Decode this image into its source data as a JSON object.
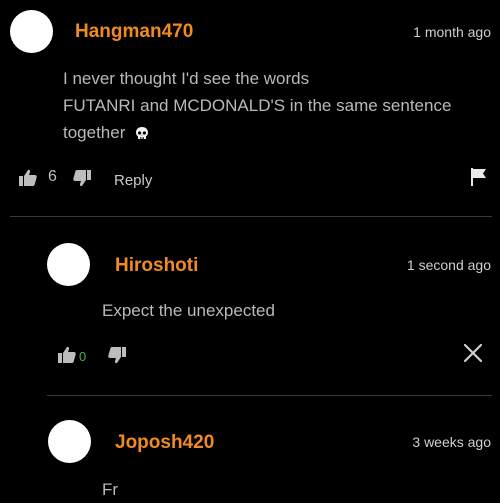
{
  "comments": [
    {
      "username": "Hangman470",
      "time": "1 month ago",
      "text": "I never thought I'd see the words\nFUTANRI and MCDONALD'S in the same sentence\ntogether",
      "likes": "6",
      "reply_label": "Reply"
    },
    {
      "username": "Hiroshoti",
      "time": "1 second ago",
      "text": "Expect the unexpected",
      "likes": "0"
    },
    {
      "username": "Joposh420",
      "time": "3 weeks ago",
      "text": "Fr"
    }
  ],
  "icons": {
    "like": "thumbs-up-icon",
    "dislike": "thumbs-down-icon",
    "flag": "flag-icon",
    "close": "close-icon",
    "emoji": "skull-emoji-icon"
  },
  "colors": {
    "background": "#000000",
    "username": "#f08a24",
    "text": "#b9b9b9",
    "like_count_active": "#3fb24a"
  }
}
